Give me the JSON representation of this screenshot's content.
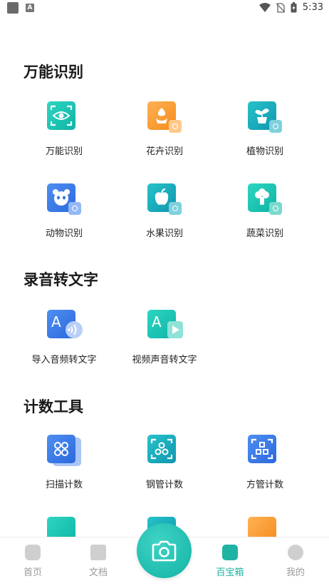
{
  "status": {
    "time": "5:33",
    "a_icon": "A"
  },
  "sections": [
    {
      "title": "万能识别",
      "items": [
        {
          "label": "万能识别",
          "icon": "eye-scan-icon",
          "color": "#18c3b2"
        },
        {
          "label": "花卉识别",
          "icon": "flower-scan-icon",
          "color": "#f59a2a"
        },
        {
          "label": "植物识别",
          "icon": "plant-scan-icon",
          "color": "#1aa6bd"
        },
        {
          "label": "动物识别",
          "icon": "panda-scan-icon",
          "color": "#2f74e3"
        },
        {
          "label": "水果识别",
          "icon": "apple-scan-icon",
          "color": "#1aa6bd"
        },
        {
          "label": "蔬菜识别",
          "icon": "broccoli-scan-icon",
          "color": "#18c3b2"
        }
      ]
    },
    {
      "title": "录音转文字",
      "items": [
        {
          "label": "导入音频转文字",
          "icon": "audio-to-text-icon",
          "color": "#2f74e3"
        },
        {
          "label": "视频声音转文字",
          "icon": "video-to-text-icon",
          "color": "#18c3b2"
        }
      ]
    },
    {
      "title": "计数工具",
      "items": [
        {
          "label": "扫描计数",
          "icon": "circles-count-icon",
          "color": "#2f74e3"
        },
        {
          "label": "钢管计数",
          "icon": "steel-pipe-count-icon",
          "color": "#1aa6bd"
        },
        {
          "label": "方管计数",
          "icon": "square-pipe-count-icon",
          "color": "#2f74e3"
        }
      ]
    }
  ],
  "nav": [
    {
      "label": "首页",
      "icon": "home-icon",
      "active": false
    },
    {
      "label": "文档",
      "icon": "document-icon",
      "active": false
    },
    {
      "label": "百宝箱",
      "icon": "toolbox-icon",
      "active": true
    },
    {
      "label": "我的",
      "icon": "profile-icon",
      "active": false
    }
  ],
  "camera": {
    "icon": "camera-icon"
  }
}
